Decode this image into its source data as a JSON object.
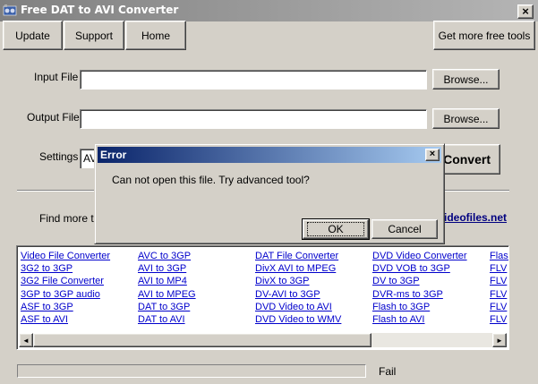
{
  "window": {
    "title": "Free DAT to AVI Converter",
    "close_glyph": "×"
  },
  "toolbar": {
    "buttons": [
      "Update",
      "Support",
      "Home"
    ],
    "right_button": "Get more free tools"
  },
  "form": {
    "input_label": "Input File",
    "input_value": "",
    "output_label": "Output File",
    "output_value": "",
    "browse_label": "Browse...",
    "settings_label": "Settings",
    "settings_value": "AVI",
    "convert_label": "Convert"
  },
  "links_section": {
    "find_more_label": "Find more tools",
    "site_link": "ideofiles.net",
    "columns": [
      [
        "Video File Converter",
        "3G2 to 3GP",
        "3G2 File Converter",
        "3GP to 3GP audio",
        "ASF to 3GP",
        "ASF to AVI"
      ],
      [
        "AVC to 3GP",
        "AVI to 3GP",
        "AVI to MP4",
        "AVI to MPEG",
        "DAT to 3GP",
        "DAT to AVI"
      ],
      [
        "DAT File Converter",
        "DivX AVI to MPEG",
        "DivX to 3GP",
        "DV-AVI to 3GP",
        "DVD Video to AVI",
        "DVD Video to WMV"
      ],
      [
        "DVD Video Converter",
        "DVD VOB to 3GP",
        "DV to 3GP",
        "DVR-ms to 3GP",
        "Flash to 3GP",
        "Flash to AVI"
      ],
      [
        "Flash",
        "FLV",
        "FLV",
        "FLV",
        "FLV",
        "FLV"
      ]
    ],
    "scroll_left_glyph": "◄",
    "scroll_right_glyph": "►"
  },
  "status": {
    "progress_fraction": 0,
    "text": "Fail"
  },
  "dialog": {
    "title": "Error",
    "close_glyph": "×",
    "message": "Can not open this file. Try advanced tool?",
    "ok_label": "OK",
    "cancel_label": "Cancel"
  },
  "colors": {
    "dialog_title_gradient_start": "#0a246a",
    "dialog_title_gradient_end": "#a6caf0",
    "inactive_title_start": "#808080",
    "link": "#0000cc",
    "face": "#d4d0c8"
  }
}
